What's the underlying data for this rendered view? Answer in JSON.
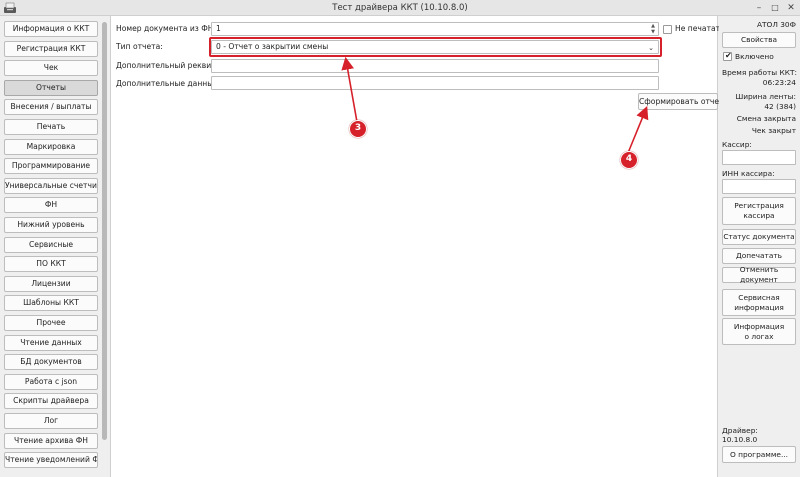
{
  "window": {
    "title": "Тест драйвера ККТ (10.10.8.0)",
    "app_icon": "kkt-printer-icon",
    "controls": {
      "minimize": "–",
      "maximize": "□",
      "close": "✕"
    }
  },
  "sidebar": {
    "active_index": 3,
    "items": [
      "Информация о ККТ",
      "Регистрация ККТ",
      "Чек",
      "Отчеты",
      "Внесения / выплаты",
      "Печать",
      "Маркировка",
      "Программирование",
      "Универсальные счетчики",
      "ФН",
      "Нижний уровень",
      "Сервисные",
      "ПО ККТ",
      "Лицензии",
      "Шаблоны ККТ",
      "Прочее",
      "Чтение данных",
      "БД документов",
      "Работа с json",
      "Скрипты драйвера",
      "Лог",
      "Чтение архива ФН",
      "Чтение уведомлений ФН"
    ]
  },
  "form": {
    "doc_number_label": "Номер документа из ФН:",
    "doc_number_value": "1",
    "no_print_label": "Не печатать",
    "no_print_checked": false,
    "report_type_label": "Тип отчета:",
    "report_type_value": "0 - Отчет о закрытии смены",
    "extra_requisite_label": "Дополнительный реквизит:",
    "extra_requisite_value": "",
    "extra_data_label": "Дополнительные данные:",
    "extra_data_value": "",
    "generate_button": "Сформировать отчет"
  },
  "annotations": {
    "color": "#d6202a",
    "badge_3": "3",
    "badge_4": "4"
  },
  "right_panel": {
    "device_name": "АТОЛ 30Ф",
    "properties_button": "Свойства",
    "enabled_label": "Включено",
    "enabled_checked": true,
    "uptime_label": "Время работы ККТ:",
    "uptime_value": "06:23:24",
    "tape_width_label": "Ширина ленты:",
    "tape_width_value": "42 (384)",
    "shift_status": "Смена закрыта",
    "receipt_status": "Чек закрыт",
    "cashier_label": "Кассир:",
    "cashier_value": "",
    "cashier_inn_label": "ИНН кассира:",
    "cashier_inn_value": "",
    "register_cashier_line1": "Регистрация",
    "register_cashier_line2": "кассира",
    "doc_status_button": "Статус документа",
    "reprint_button": "Допечатать",
    "cancel_doc_button": "Отменить документ",
    "service_info_line1": "Сервисная",
    "service_info_line2": "информация",
    "logs_info_line1": "Информация",
    "logs_info_line2": "о логах",
    "driver_label": "Драйвер:",
    "driver_version": "10.10.8.0",
    "about_button": "О программе..."
  }
}
